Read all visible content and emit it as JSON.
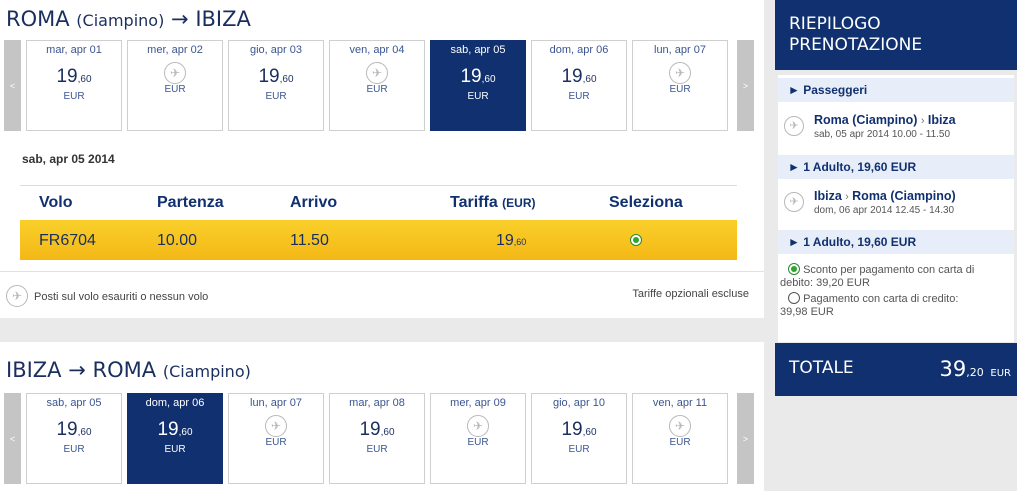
{
  "outbound": {
    "route_from": "ROMA",
    "route_from_sub": "(Ciampino)",
    "route_arrow": "→",
    "route_to": "IBIZA",
    "prev": "<",
    "next": ">",
    "days": [
      {
        "date": "mar, apr 01",
        "price": "19",
        "cents": ",60",
        "currency": "EUR",
        "available": true
      },
      {
        "date": "mer, apr 02",
        "price": "",
        "cents": "",
        "currency": "EUR",
        "available": false
      },
      {
        "date": "gio, apr 03",
        "price": "19",
        "cents": ",60",
        "currency": "EUR",
        "available": true
      },
      {
        "date": "ven, apr 04",
        "price": "",
        "cents": "",
        "currency": "EUR",
        "available": false
      },
      {
        "date": "sab, apr 05",
        "price": "19",
        "cents": ",60",
        "currency": "EUR",
        "available": true,
        "selected": true
      },
      {
        "date": "dom, apr 06",
        "price": "19",
        "cents": ",60",
        "currency": "EUR",
        "available": true
      },
      {
        "date": "lun, apr 07",
        "price": "",
        "cents": "",
        "currency": "EUR",
        "available": false
      }
    ],
    "selected_date": "sab, apr 05 2014",
    "headers": {
      "volo": "Volo",
      "partenza": "Partenza",
      "arrivo": "Arrivo",
      "tariffa": "Tariffa",
      "tariffa_unit": "(EUR)",
      "seleziona": "Seleziona"
    },
    "flight": {
      "number": "FR6704",
      "dep": "10.00",
      "arr": "11.50",
      "fare": "19",
      "fare_cents": ",60"
    },
    "legend": "Posti sul volo esauriti o nessun volo",
    "optional": "Tariffe opzionali escluse"
  },
  "inbound": {
    "route_from": "IBIZA",
    "route_arrow": "→",
    "route_to": "ROMA",
    "route_to_sub": "(Ciampino)",
    "prev": "<",
    "next": ">",
    "days": [
      {
        "date": "sab, apr 05",
        "price": "19",
        "cents": ",60",
        "currency": "EUR",
        "available": true
      },
      {
        "date": "dom, apr 06",
        "price": "19",
        "cents": ",60",
        "currency": "EUR",
        "available": true,
        "selected": true
      },
      {
        "date": "lun, apr 07",
        "price": "",
        "cents": "",
        "currency": "EUR",
        "available": false
      },
      {
        "date": "mar, apr 08",
        "price": "19",
        "cents": ",60",
        "currency": "EUR",
        "available": true
      },
      {
        "date": "mer, apr 09",
        "price": "",
        "cents": "",
        "currency": "EUR",
        "available": false
      },
      {
        "date": "gio, apr 10",
        "price": "19",
        "cents": ",60",
        "currency": "EUR",
        "available": true
      },
      {
        "date": "ven, apr 11",
        "price": "",
        "cents": "",
        "currency": "EUR",
        "available": false
      }
    ]
  },
  "summary": {
    "title_line1": "RIEPILOGO",
    "title_line2": "PRENOTAZIONE",
    "passengers": "► Passeggeri",
    "out_route_from": "Roma (Ciampino)",
    "out_route_sep": "›",
    "out_route_to": "Ibiza",
    "out_time": "sab, 05 apr 2014 10.00 - 11.50",
    "out_fare": "► 1 Adulto, 19,60 EUR",
    "in_route_from": "Ibiza",
    "in_route_sep": "›",
    "in_route_to": "Roma (Ciampino)",
    "in_time": "dom, 06 apr 2014 12.45 - 14.30",
    "in_fare": "► 1 Adulto, 19,60 EUR",
    "debit_line1": "Sconto per pagamento con carta di",
    "debit_line2": "debito: 39,20 EUR",
    "credit_line1": "Pagamento con carta di credito:",
    "credit_line2": "39,98 EUR",
    "total_label": "TOTALE",
    "total_amount": "39",
    "total_cents": ",20",
    "total_currency": "EUR"
  },
  "colors": {
    "navy": "#10306f",
    "yellow": "#f7c31a",
    "light_blue": "#e8eef9"
  }
}
